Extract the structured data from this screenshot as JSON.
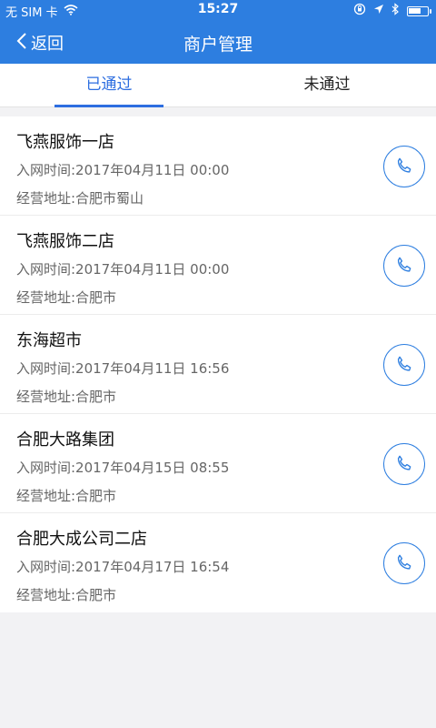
{
  "status_bar": {
    "carrier": "无 SIM 卡",
    "time": "15:27",
    "battery_level": 0.7
  },
  "nav": {
    "back_label": "返回",
    "title": "商户管理"
  },
  "tabs": [
    {
      "label": "已通过",
      "active": true
    },
    {
      "label": "未通过",
      "active": false
    }
  ],
  "merchants": [
    {
      "name": "飞燕服饰一店",
      "join_time": "入网时间:2017年04月11日 00:00",
      "address": "经营地址:合肥市蜀山"
    },
    {
      "name": "飞燕服饰二店",
      "join_time": "入网时间:2017年04月11日 00:00",
      "address": "经营地址:合肥市"
    },
    {
      "name": "东海超市",
      "join_time": "入网时间:2017年04月11日 16:56",
      "address": "经营地址:合肥市"
    },
    {
      "name": "合肥大路集团",
      "join_time": "入网时间:2017年04月15日 08:55",
      "address": "经营地址:合肥市"
    },
    {
      "name": "合肥大成公司二店",
      "join_time": "入网时间:2017年04月17日 16:54",
      "address": "经营地址:合肥市"
    }
  ],
  "colors": {
    "header": "#2d7ee0",
    "active_tab": "#2d6ee0",
    "background": "#f2f2f4"
  },
  "icons": [
    "wifi-icon",
    "location-arrow-icon",
    "bluetooth-icon",
    "battery-icon",
    "chevron-left-icon",
    "phone-icon"
  ]
}
